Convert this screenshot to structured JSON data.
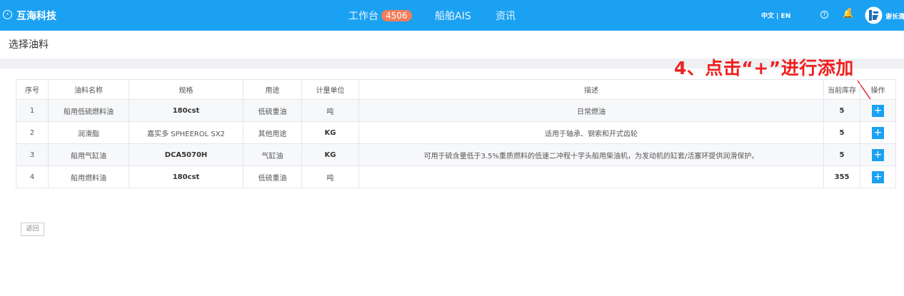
{
  "header": {
    "brand": "互海科技",
    "nav": {
      "workbench": "工作台",
      "workbench_badge": "4506",
      "ais": "船舶AIS",
      "news": "资讯"
    },
    "lang": "中文 | EN",
    "username": "谢长清"
  },
  "page": {
    "title": "选择油料",
    "return_label": "返回"
  },
  "annotation": "4、点击“+”进行添加",
  "table": {
    "headers": [
      "序号",
      "油料名称",
      "规格",
      "用途",
      "计量单位",
      "描述",
      "当前库存",
      "操作"
    ],
    "rows": [
      {
        "no": "1",
        "name": "船用低硫燃料油",
        "spec": "180cst",
        "usage": "低硫重油",
        "unit": "吨",
        "desc": "日常燃油",
        "stock": "5"
      },
      {
        "no": "2",
        "name": "润滑脂",
        "spec": "嘉实多 SPHEEROL SX2",
        "usage": "其他用途",
        "unit": "KG",
        "desc": "适用于轴承、钢索和开式齿轮",
        "stock": "5"
      },
      {
        "no": "3",
        "name": "船用气缸油",
        "spec": "DCA5070H",
        "usage": "气缸油",
        "unit": "KG",
        "desc": "可用于硫含量低于3.5%重质燃料的低速二冲程十字头船用柴油机，为发动机的缸套/活塞环提供润滑保护。",
        "stock": "5"
      },
      {
        "no": "4",
        "name": "船用燃料油",
        "spec": "180cst",
        "usage": "低硫重油",
        "unit": "吨",
        "desc": "",
        "stock": "355"
      }
    ],
    "add_label": "+"
  },
  "colors": {
    "topbar": "#1ba1f2",
    "badge": "#f47c5a",
    "annotation": "#f02020",
    "add_button": "#1ba1f2"
  }
}
